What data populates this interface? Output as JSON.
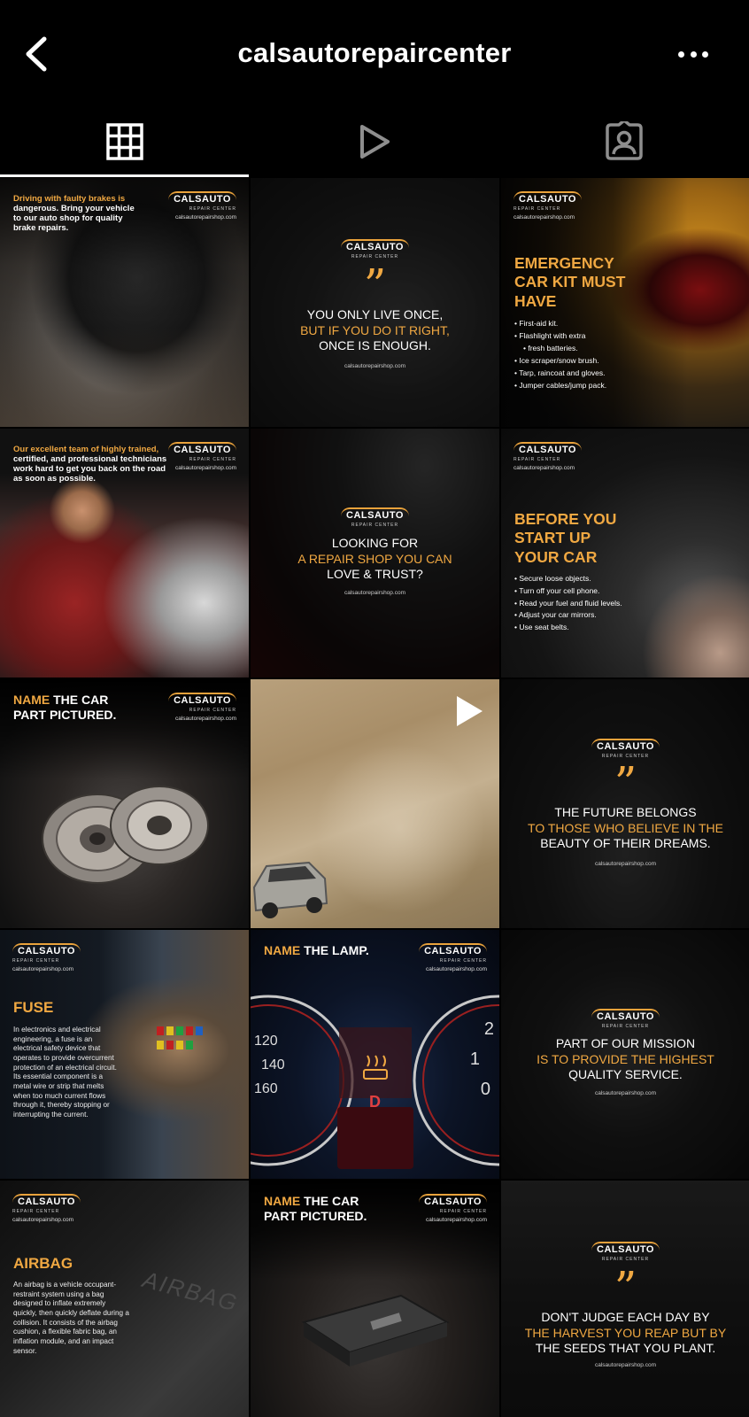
{
  "header": {
    "title": "calsautorepaircenter"
  },
  "tabs": [
    {
      "name": "posts",
      "icon": "grid-icon",
      "active": true
    },
    {
      "name": "reels",
      "icon": "play-icon",
      "active": false
    },
    {
      "name": "tagged",
      "icon": "tagged-person-icon",
      "active": false
    }
  ],
  "brand": {
    "logo": "CALSAUTO",
    "logo_sub": "REPAIR CENTER",
    "url": "calsautorepairshop.com",
    "accent": "#f0a842"
  },
  "posts": {
    "p1": {
      "caption_orange": "Driving with faulty brakes is",
      "caption_white": "dangerous. Bring your vehicle to our auto shop for quality brake repairs."
    },
    "p2": {
      "line1": "YOU ONLY LIVE ONCE,",
      "line2": "BUT IF YOU DO IT RIGHT,",
      "line3": "ONCE IS ENOUGH."
    },
    "p3": {
      "headline_1": "EMERGENCY",
      "headline_2": "CAR KIT MUST",
      "headline_3": "HAVE",
      "items": [
        "First-aid kit.",
        "Flashlight with extra",
        "fresh batteries.",
        "Ice scraper/snow brush.",
        "Tarp, raincoat and gloves.",
        "Jumper cables/jump pack."
      ]
    },
    "p4": {
      "caption_orange": "Our excellent team of highly trained,",
      "caption_white": "certified, and professional technicians work hard to get you back on the road as soon as possible."
    },
    "p5": {
      "line1": "LOOKING FOR",
      "line2": "A REPAIR SHOP YOU CAN",
      "line3": "LOVE & TRUST?"
    },
    "p6": {
      "headline_1": "BEFORE YOU",
      "headline_2": "START UP",
      "headline_3": "YOUR CAR",
      "items": [
        "Secure loose objects.",
        "Turn off your cell phone.",
        "Read your fuel and fluid levels.",
        "Adjust your car mirrors.",
        "Use seat belts."
      ]
    },
    "p7": {
      "name_word": "NAME",
      "rest": "THE CAR",
      "line2": "PART PICTURED."
    },
    "p8": {
      "type": "video"
    },
    "p9": {
      "line1": "THE FUTURE BELONGS",
      "line2": "TO THOSE WHO BELIEVE IN THE",
      "line3": "BEAUTY OF THEIR DREAMS."
    },
    "p10": {
      "headline": "FUSE",
      "body": "In electronics and electrical engineering, a fuse is an electrical safety device that operates to provide overcurrent protection of an electrical circuit. Its essential component is a metal wire or strip that melts when too much current flows through it, thereby stopping or interrupting the current."
    },
    "p11": {
      "name_word": "NAME",
      "rest": "THE LAMP.",
      "gauge_left": [
        "120",
        "140",
        "160"
      ],
      "gauge_right": [
        "2",
        "1",
        "0"
      ],
      "gear": "D"
    },
    "p12": {
      "line1": "PART OF OUR MISSION",
      "line2": "IS TO PROVIDE THE HIGHEST",
      "line3": "QUALITY SERVICE."
    },
    "p13": {
      "headline": "AIRBAG",
      "body": "An airbag is a vehicle occupant-restraint system using a bag designed to inflate extremely quickly, then quickly deflate during a collision. It consists of the airbag cushion, a flexible fabric bag, an inflation module, and an impact sensor.",
      "emboss": "AIRBAG"
    },
    "p14": {
      "name_word": "NAME",
      "rest": "THE CAR",
      "line2": "PART PICTURED."
    },
    "p15": {
      "line1": "DON'T JUDGE EACH DAY BY",
      "line2": "THE HARVEST YOU REAP BUT BY",
      "line3": "THE SEEDS THAT YOU PLANT."
    }
  }
}
